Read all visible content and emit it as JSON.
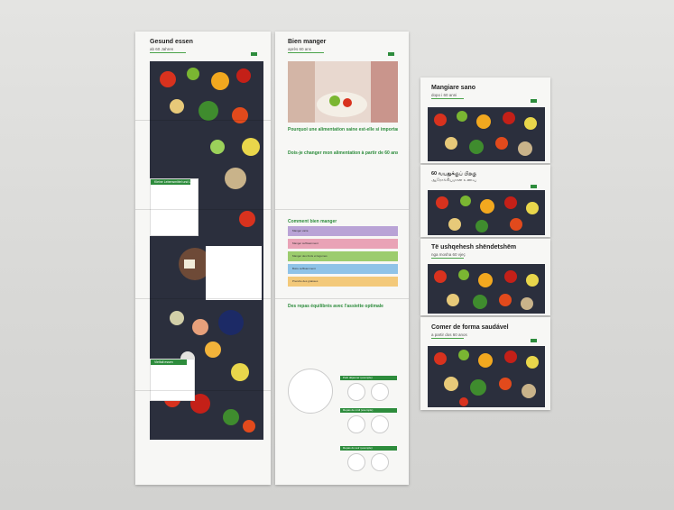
{
  "leaflet_de": {
    "title": "Gesund essen",
    "subtitle": "ab 60 Jahren",
    "box1_title": "Kleine Lebensmittel und Lebensweisen",
    "box2_title": "Vielfalt essen"
  },
  "leaflet_fr": {
    "title": "Bien manger",
    "subtitle": "après 60 ans",
    "q1": "Pourquoi une alimentation saine est-elle si importante?",
    "q2": "Dois-je changer mon alimentation à partir de 60 ans?",
    "how_title": "Comment bien manger",
    "bars": [
      {
        "label": "Manger varié",
        "color": "#b9a3d6"
      },
      {
        "label": "Manger suffisamment",
        "color": "#e9a3b6"
      },
      {
        "label": "Manger des fruits et légumes",
        "color": "#9ccc6e"
      },
      {
        "label": "Boire suffisamment",
        "color": "#8fc3e8"
      },
      {
        "label": "Prendre des graisses",
        "color": "#f3c97a"
      }
    ],
    "plate_title": "Des repas équilibrés avec l'assiette optimale",
    "meal_labels": [
      "Petit déjeuner (exemple)",
      "Repas de midi (exemple)",
      "Repas du soir (exemple)"
    ]
  },
  "small_leaflets": [
    {
      "title": "Mangiare sano",
      "subtitle": "dopo i 60 anni"
    },
    {
      "title": "60 வயதுக்குப் பிறகு",
      "subtitle": "ஆரோக்கியமான உணவு"
    },
    {
      "title": "Të ushqehesh shëndetshëm",
      "subtitle": "nga mosha 60 vjeç"
    },
    {
      "title": "Comer de forma saudável",
      "subtitle": "a partir dos 60 anos"
    }
  ],
  "colors": {
    "brand_green": "#2d8c3c",
    "veg_background": "#2b2f3d"
  }
}
